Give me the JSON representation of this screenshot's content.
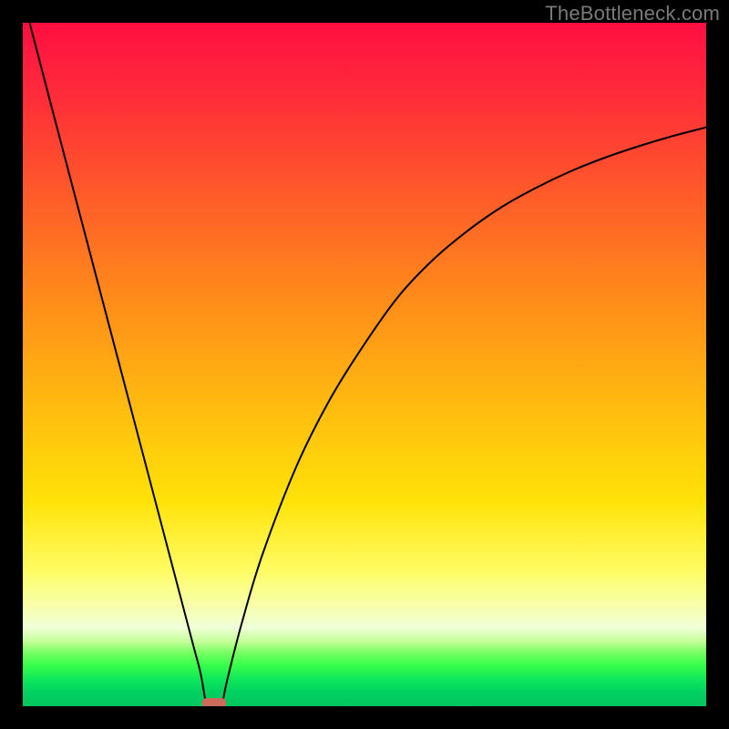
{
  "watermark": "TheBottleneck.com",
  "chart_data": {
    "type": "line",
    "title": "",
    "xlabel": "",
    "ylabel": "",
    "xlim": [
      0,
      100
    ],
    "ylim": [
      0,
      100
    ],
    "grid": false,
    "series": [
      {
        "name": "left-branch",
        "x": [
          1,
          5,
          10,
          15,
          20,
          23,
          25,
          26,
          26.7
        ],
        "values": [
          100,
          84.7,
          65.7,
          46.7,
          27.7,
          16.3,
          8.7,
          4.9,
          0.9
        ]
      },
      {
        "name": "right-branch",
        "x": [
          29.3,
          30,
          32,
          35,
          40,
          45,
          50,
          55,
          60,
          65,
          70,
          75,
          80,
          85,
          90,
          95,
          100
        ],
        "values": [
          0.9,
          4.2,
          12,
          22,
          35,
          45,
          53,
          60,
          65.3,
          69.5,
          73,
          75.8,
          78.2,
          80.2,
          81.9,
          83.4,
          84.7
        ]
      }
    ],
    "annotations": [
      {
        "name": "min-marker",
        "shape": "rounded-rect",
        "x": 28,
        "y": 0.5,
        "w": 3.6,
        "h": 1.4,
        "color": "#cc6a5c"
      }
    ]
  },
  "colors": {
    "frame": "#000000",
    "curve": "#000000",
    "marker": "#cc6a5c",
    "watermark": "#7a7a7a"
  }
}
